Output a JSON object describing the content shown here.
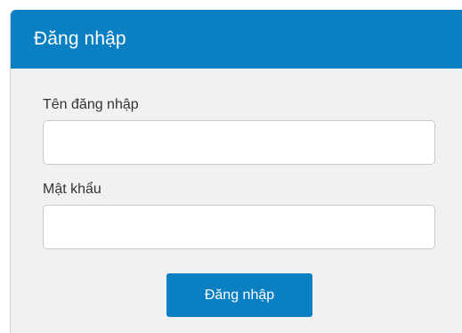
{
  "login_panel": {
    "title": "Đăng nhập",
    "username": {
      "label": "Tên đăng nhập",
      "value": "",
      "placeholder": ""
    },
    "password": {
      "label": "Mật khẩu",
      "value": "",
      "placeholder": ""
    },
    "submit_label": "Đăng nhập"
  },
  "colors": {
    "header_background": "#0a7fc2",
    "panel_background": "#f1f1f1",
    "button_background": "#0a7fc2",
    "button_text": "#ffffff"
  }
}
